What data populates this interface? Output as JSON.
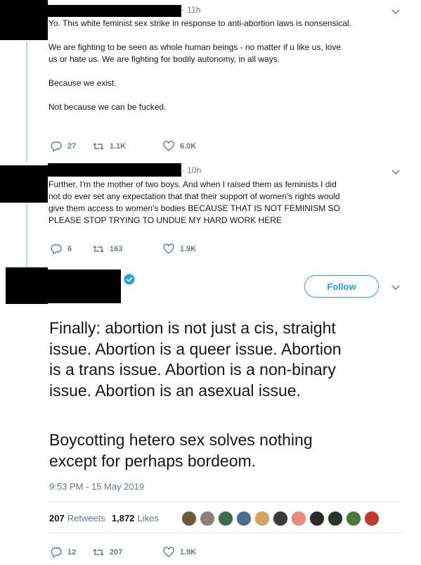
{
  "tweet1": {
    "time": "· 11h",
    "paragraphs": [
      "Yo. This white feminist sex strike in response to anti-abortion laws is nonsensical.",
      "We are fighting to be seen as whole human beings - no matter if u like us, love",
      "us or hate us. We are fighting for bodily autonomy, in all ways.",
      "Because we exist.",
      "Not because we can be fucked."
    ],
    "replies": "27",
    "retweets": "1.1K",
    "likes": "6.0K"
  },
  "tweet2": {
    "time": "· 10h",
    "lines": [
      "Further, I'm the mother of two boys. And when I raised them as feminists I did",
      "not do ever set any expectation  that that their support of women's rights would",
      "give them access to women's bodies BECAUSE THAT IS NOT FEMINISM SO",
      "PLEASE STOP TRYING TO UNDUE MY HARD WORK HERE"
    ],
    "replies": "6",
    "retweets": "163",
    "likes": "1.9K"
  },
  "main_tweet": {
    "follow_label": "Follow",
    "lines1": [
      "Finally: abortion is not just a cis, straight",
      "issue. Abortion is a queer issue. Abortion",
      "is a trans issue. Abortion is a non-binary",
      "issue. Abortion is an asexual issue."
    ],
    "lines2": [
      "Boycotting hetero sex solves nothing",
      "except for perhaps bordeom."
    ],
    "timestamp": "9:53 PM - 15 May 2019",
    "retweet_count": "207",
    "retweet_label": "Retweets",
    "like_count": "1,872",
    "like_label": "Likes",
    "replies": "12",
    "retweets": "207",
    "likes": "1.9K",
    "avatar_colors": [
      "#6b5a3a",
      "#8c7f7a",
      "#3e6b4a",
      "#4a6d8c",
      "#d9a35a",
      "#3a3a3a",
      "#e88a7a",
      "#2e2a28",
      "#1f3a2a",
      "#4a7a3a",
      "#c0392b"
    ]
  },
  "colors": {
    "accent": "#1da1f2",
    "muted": "#657786",
    "thread_line": "#b5d9ff",
    "like_red": "#e0245e"
  }
}
